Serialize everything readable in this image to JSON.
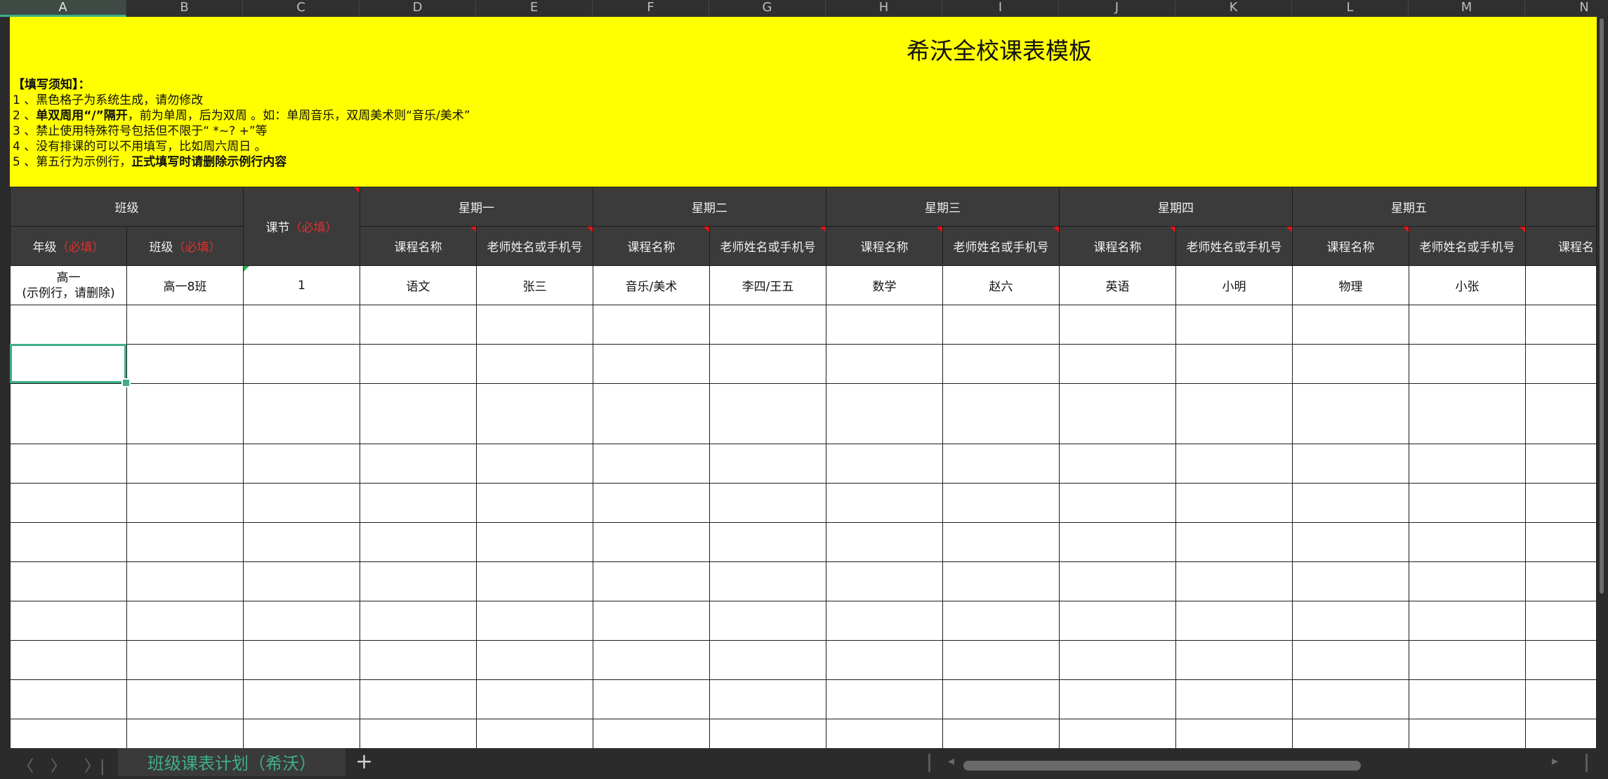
{
  "column_letters": [
    "A",
    "B",
    "C",
    "D",
    "E",
    "F",
    "G",
    "H",
    "I",
    "J",
    "K",
    "L",
    "M",
    "N"
  ],
  "active_column": "A",
  "banner": {
    "title": "希沃全校课表模板",
    "heading": "【填写须知】：",
    "notes": [
      {
        "pre": "1 、黑色格子为系统生成，请勿修改",
        "bold": "",
        "post": ""
      },
      {
        "pre": "2 、",
        "bold": "单双周用“/”隔开",
        "post": "，前为单周，后为双周 。如：单周音乐，双周美术则“音乐/美术”"
      },
      {
        "pre": "3 、禁止使用特殊符号包括但不限于“ *~? +”等",
        "bold": "",
        "post": ""
      },
      {
        "pre": "4 、没有排课的可以不用填写，比如周六周日 。",
        "bold": "",
        "post": ""
      },
      {
        "pre": "5 、第五行为示例行，",
        "bold": "正式填写时请删除示例行内容",
        "post": ""
      }
    ]
  },
  "header": {
    "class_group": "班级",
    "grade_label": "年级",
    "class_label": "班级",
    "period_label": "课节",
    "required": "（必填）",
    "days": [
      "星期一",
      "星期二",
      "星期三",
      "星期四",
      "星期五",
      ""
    ],
    "course_name": "课程名称",
    "teacher": "老师姓名或手机号",
    "course_name_partial": "课程名"
  },
  "example_row": {
    "grade_line1": "高一",
    "grade_line2": "(示例行，请删除)",
    "class": "高一8班",
    "period": "1",
    "cells": [
      "语文",
      "张三",
      "音乐/美术",
      "李四/王五",
      "数学",
      "赵六",
      "英语",
      "小明",
      "物理",
      "小张",
      ""
    ]
  },
  "bottom": {
    "nav_prev": "〈",
    "nav_next": "〉",
    "nav_last": "〉|",
    "sheet_tab": "班级课表计划（希沃）",
    "add_sheet": "+",
    "scroll_left": "◂",
    "scroll_right": "▸"
  },
  "colors": {
    "banner": "#ffff00",
    "header_bg": "#3b3b3b",
    "accent": "#3fae8a",
    "required": "#e03030"
  }
}
